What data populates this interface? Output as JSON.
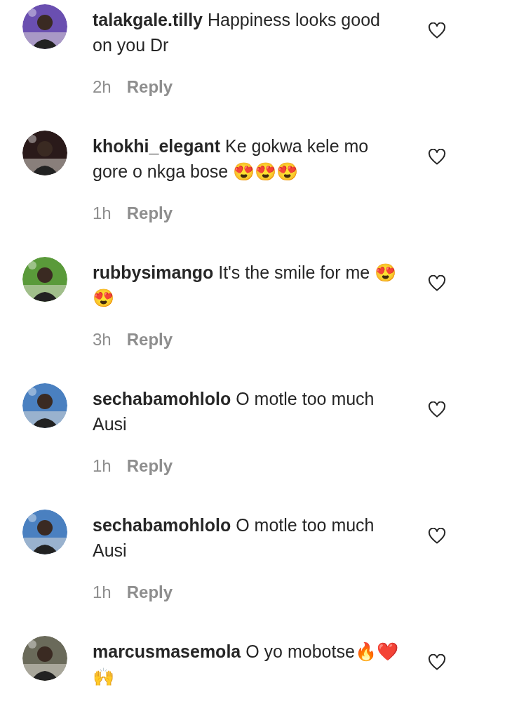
{
  "comments": [
    {
      "username": "talakgale.tilly",
      "text": "Happiness looks good on you Dr",
      "time": "2h",
      "reply": "Reply",
      "liked": false
    },
    {
      "username": "khokhi_elegant",
      "text": "Ke gokwa kele mo gore o nkga bose 😍😍😍",
      "time": "1h",
      "reply": "Reply",
      "liked": false
    },
    {
      "username": "rubbysimango",
      "text": "It's the smile for me 😍😍",
      "time": "3h",
      "reply": "Reply",
      "liked": false
    },
    {
      "username": "sechabamohlolo",
      "text": "O motle too much Ausi",
      "time": "1h",
      "reply": "Reply",
      "liked": false
    },
    {
      "username": "sechabamohlolo",
      "text": "O motle too much Ausi",
      "time": "1h",
      "reply": "Reply",
      "liked": false
    },
    {
      "username": "marcusmasemola",
      "text": "O yo mobotse🔥❤️🙌",
      "liked": false
    }
  ]
}
